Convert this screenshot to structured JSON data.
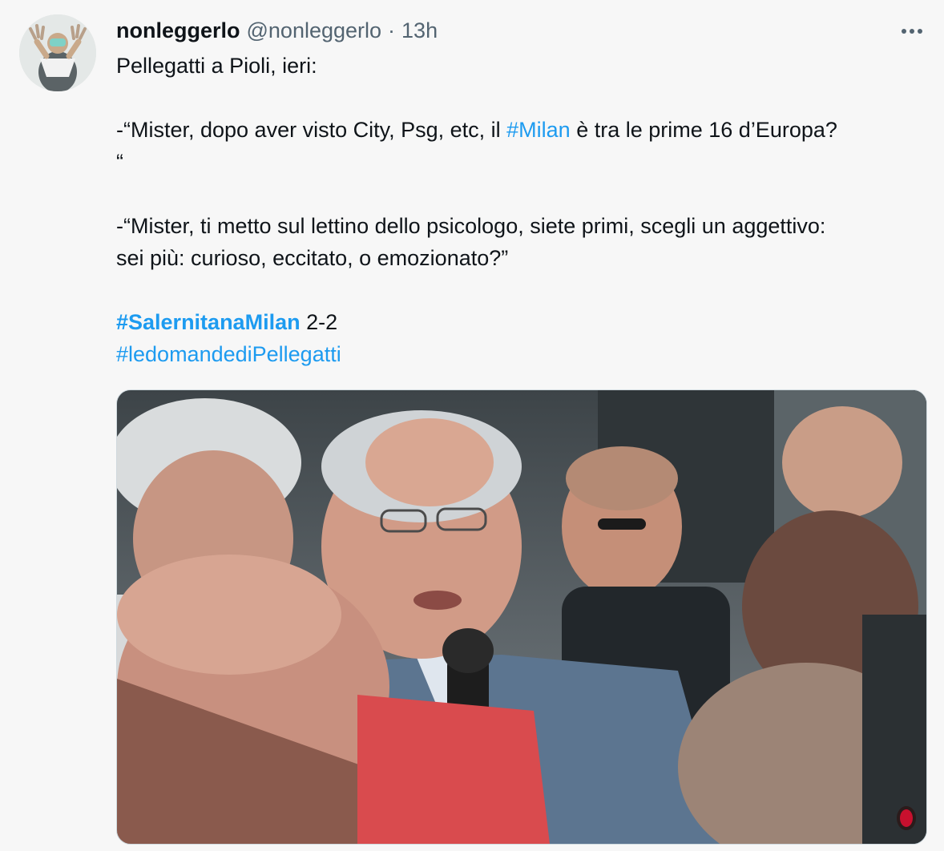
{
  "tweet": {
    "display_name": "nonleggerlo",
    "handle": "@nonleggerlo",
    "separator": "·",
    "timestamp": "13h",
    "lines": {
      "l1": "Pellegatti a Pioli, ieri:",
      "q1_pre": "-“Mister, dopo aver visto City, Psg, etc, il ",
      "q1_tag": "#Milan",
      "q1_post": " è tra le prime 16 d’Europa?",
      "q1_end": "“",
      "q2_a": "-“Mister, ti metto sul lettino dello psicologo, siete primi, scegli un aggettivo:",
      "q2_b": "sei più: curioso, eccitato, o emozionato?”",
      "score_tag": "#SalernitanaMilan",
      "score": " 2-2",
      "tag2": "#ledomandediPellegatti"
    }
  },
  "icons": {
    "more": "more-horizontal-icon",
    "media_logo": "ac-milan-logo-icon"
  },
  "colors": {
    "background": "#f7f7f7",
    "text": "#0f1419",
    "secondary": "#536471",
    "link": "#1d9bf0"
  }
}
